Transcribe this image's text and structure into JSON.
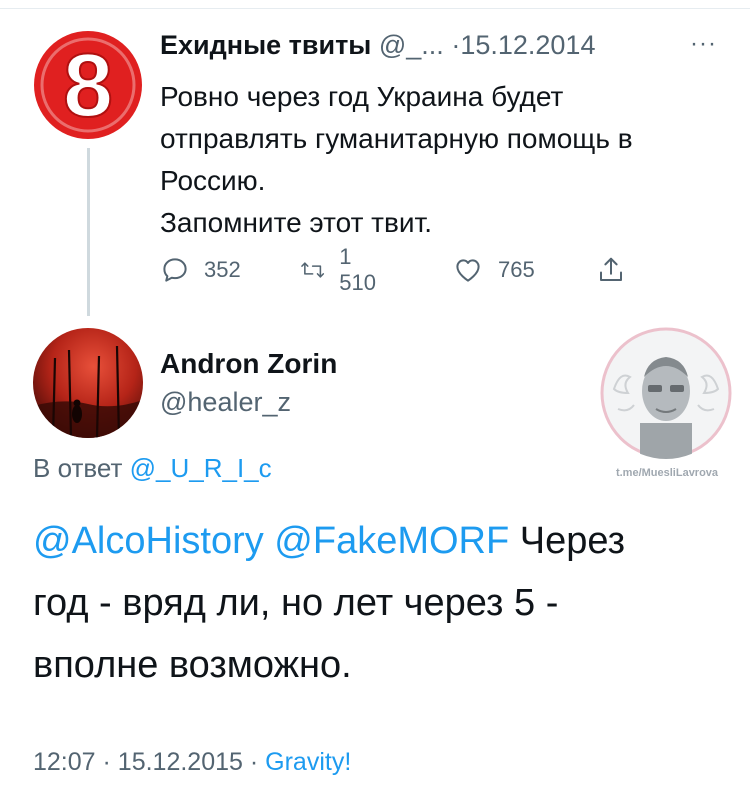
{
  "parent_tweet": {
    "author_name": "Ехидные твиты",
    "handle": "@_...",
    "separator": "·",
    "date": "15.12.2014",
    "more": "···",
    "avatar_glyph": "8",
    "text_lines": [
      "Ровно через год Украина будет",
      "отправлять гуманитарную помощь в",
      "Россию.",
      "Запомните этот твит."
    ],
    "reply_count": "352",
    "retweet_count": "1 510",
    "like_count": "765"
  },
  "reply_tweet": {
    "author_name": "Andron Zorin",
    "handle": "@healer_z",
    "reply_to_label": "В ответ",
    "reply_to_handle": "@_U_R_I_c",
    "text_lines": [
      {
        "mentions": "@AlcoHistory @FakeMORF",
        "text": " Через"
      },
      {
        "mentions": "",
        "text": "год - вряд ли, но лет через 5 -"
      },
      {
        "mentions": "",
        "text": "вполне возможно."
      }
    ],
    "time": "12:07",
    "separator": "·",
    "date": "15.12.2015",
    "source": "Gravity!"
  },
  "watermark": {
    "caption": "t.me/MuesliLavrova"
  },
  "colors": {
    "link": "#1d9bf0",
    "secondary_text": "#536471",
    "primary_text": "#0f1419",
    "avatar_red": "#e02020"
  }
}
